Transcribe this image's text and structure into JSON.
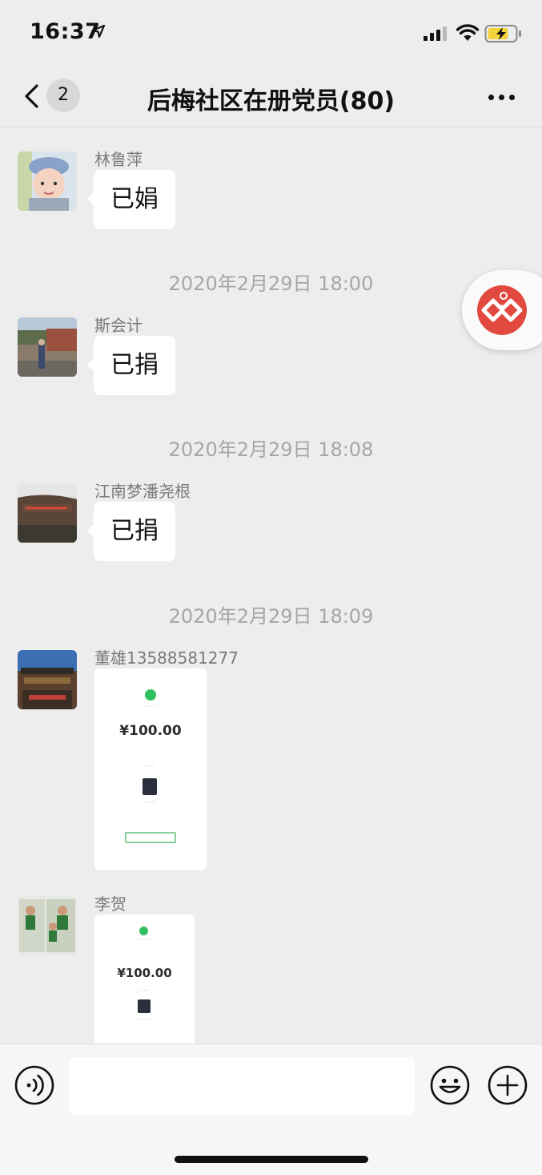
{
  "status_bar": {
    "time": "16:37"
  },
  "nav": {
    "unread_count": "2",
    "title": "后梅社区在册党员(80)"
  },
  "messages": [
    {
      "sender": "林鲁萍",
      "text": "已娟"
    },
    {
      "timestamp": "2020年2月29日 18:00"
    },
    {
      "sender": "斯会计",
      "text": "已捐"
    },
    {
      "timestamp": "2020年2月29日 18:08"
    },
    {
      "sender": "江南梦潘尧根",
      "text": "已捐"
    },
    {
      "timestamp": "2020年2月29日 18:09"
    },
    {
      "sender": "董雄13588581277",
      "image": {
        "amount": "¥100.00"
      }
    },
    {
      "sender": "李贺",
      "image": {
        "amount": "¥100.00"
      }
    }
  ],
  "colors": {
    "background": "#ededed",
    "bubble": "#ffffff",
    "wechat_green": "#2fbf5f",
    "accent_red": "#e34a3f"
  },
  "icons": [
    "location-arrow-icon",
    "signal-icon",
    "wifi-icon",
    "battery-charging-icon",
    "back-chevron-icon",
    "more-dots-icon",
    "party-badge-icon",
    "voice-icon",
    "emoji-icon",
    "plus-icon"
  ]
}
